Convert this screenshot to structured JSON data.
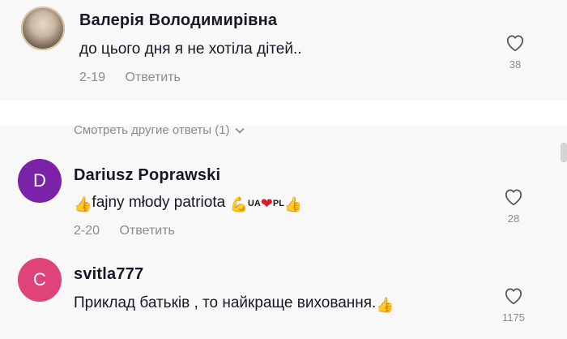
{
  "comments": [
    {
      "author": "Валерія Володимирівна",
      "text": "до цього дня я не хотіла дітей..",
      "date": "2-19",
      "reply_label": "Ответить",
      "likes": "38",
      "avatar_type": "photo"
    },
    {
      "author": "Dariusz Poprawski",
      "text_parts": {
        "emoji_thumb_1": "👍",
        "main": "fajny młody patriota ",
        "emoji_muscle": "💪",
        "ua_label": "UA",
        "heart": "❤",
        "pl_label": "PL",
        "emoji_thumb_2": "👍"
      },
      "date": "2-20",
      "reply_label": "Ответить",
      "likes": "28",
      "avatar_letter": "D",
      "avatar_color": "#7b22a8"
    },
    {
      "author": "svitla777",
      "text_parts": {
        "main": "Приклад батьків , то найкраще виховання.",
        "emoji_thumb": "👍"
      },
      "likes": "1175",
      "avatar_letter": "C",
      "avatar_color": "#e0437a"
    }
  ],
  "more_replies_label": "Смотреть другие ответы (1)",
  "icons": {
    "like": "heart-outline-icon",
    "chevron": "chevron-down-icon"
  }
}
